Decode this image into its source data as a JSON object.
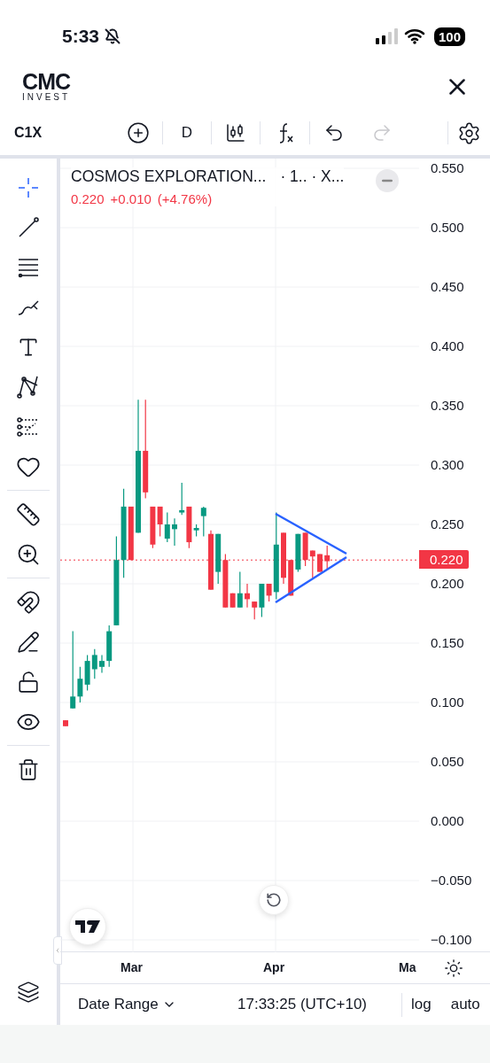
{
  "status_bar": {
    "time": "5:33",
    "battery": "100"
  },
  "header": {
    "logo": "CMC",
    "logo_subtitle": "INVEST"
  },
  "toolbar": {
    "symbol": "C1X",
    "interval": "D",
    "undo": {
      "disabled": false
    },
    "redo": {
      "disabled": true
    }
  },
  "left_toolbar": {
    "groups": [
      {
        "tools": [
          {
            "kind": "crosshair",
            "selected": true
          },
          {
            "kind": "trendline",
            "selected": false
          },
          {
            "kind": "fib",
            "selected": false
          },
          {
            "kind": "brush",
            "selected": false
          },
          {
            "kind": "text",
            "selected": false
          },
          {
            "kind": "pattern",
            "selected": false
          },
          {
            "kind": "projection",
            "selected": false
          },
          {
            "kind": "heart",
            "selected": false
          }
        ]
      },
      {
        "tools": [
          {
            "kind": "ruler",
            "selected": false
          },
          {
            "kind": "zoom",
            "selected": false
          }
        ]
      },
      {
        "tools": [
          {
            "kind": "magnet",
            "selected": false
          },
          {
            "kind": "pencil-lock",
            "selected": false
          },
          {
            "kind": "lock",
            "selected": false
          },
          {
            "kind": "eye",
            "selected": false
          }
        ]
      },
      {
        "tools": [
          {
            "kind": "trash",
            "selected": false
          }
        ]
      }
    ]
  },
  "legend": {
    "title": "COSMOS EXPLORATION...",
    "details": "· 1.. · X...",
    "last": "0.220",
    "change": "+0.010",
    "change_percent": "(+4.76%)"
  },
  "price_axis": {
    "labels": [
      "0.550",
      "0.500",
      "0.450",
      "0.400",
      "0.350",
      "0.300",
      "0.250",
      "0.200",
      "0.150",
      "0.100",
      "0.050",
      "0.000",
      "−0.050",
      "−0.100"
    ],
    "current_price": "0.220"
  },
  "time_axis": {
    "labels": [
      "Mar",
      "Apr",
      "Ma"
    ]
  },
  "bottom_bar": {
    "date_range": "Date Range",
    "clock": "17:33:25 (UTC+10)",
    "log": "log",
    "auto": "auto"
  }
}
